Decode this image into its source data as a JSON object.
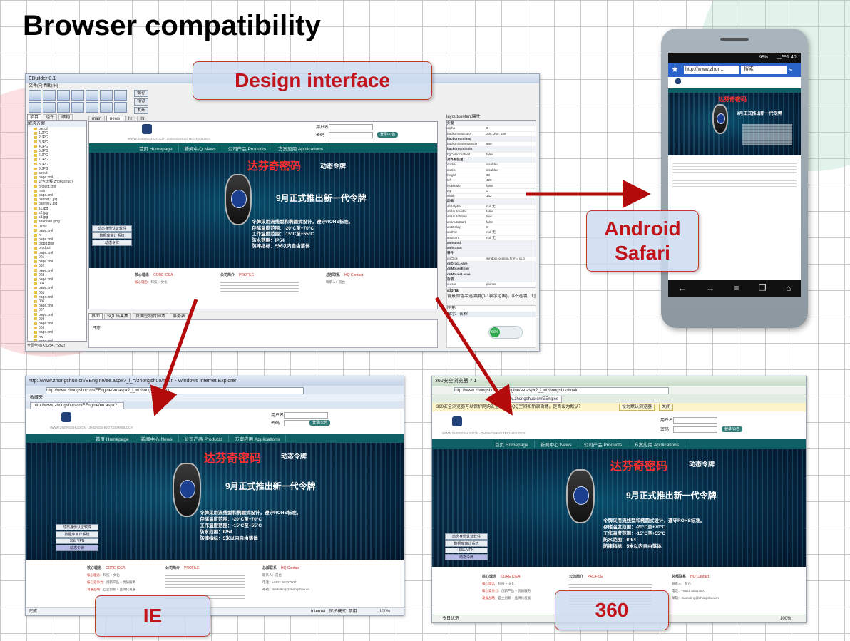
{
  "slide": {
    "title": "Browser compatibility",
    "callouts": {
      "design": "Design interface",
      "android_line1": "Android",
      "android_line2": "Safari",
      "ie": "IE",
      "b360": "360"
    }
  },
  "website": {
    "brand": "WWW.ZHONGSHUO.CN - ZHONGSHUO TECHNOLOGY",
    "login": {
      "user_label": "用户名",
      "pass_label": "密码",
      "button": "登录/公告"
    },
    "nav": [
      "首页 Homepage",
      "新闻中心 News",
      "公司产品 Products",
      "方案应用 Applications"
    ],
    "banner": {
      "product": "达芬奇密码",
      "product_sub": "动态令牌",
      "headline": "9月正式推出新一代令牌",
      "specs": [
        "令牌采用流线型和椭圆式设计，遵守ROHS标准。",
        "存储温度范围：-20°C至+70°C",
        "工作温度范围：-15°C至+55°C",
        "防水范围：IP54",
        "防摔指标：5米以内自由落体"
      ]
    },
    "side_menu": [
      "动态身份认证软件",
      "数据库审计系统",
      "SSL VPN",
      "动态令牌"
    ],
    "footer": {
      "col1_title": "核心理念",
      "col1_sub": "CORE IDEA",
      "col1_lines": [
        {
          "k": "核心理念：",
          "v": "科技 + 文化"
        },
        {
          "k": "核心竞争力：",
          "v": "创新产品 + 优质服务"
        },
        {
          "k": "发展战略：",
          "v": "自主创新 + 品牌化发展"
        }
      ],
      "col2_title": "公司简介",
      "col2_sub": "PROFILE",
      "col3_title": "总部联系",
      "col3_sub": "HQ Contact",
      "col3_lines": [
        "联系人：前台",
        "电话：+8621 50327007",
        "邮箱：marketing@zhongshuo.cn"
      ]
    }
  },
  "ide": {
    "title": "EBuilder 0.1",
    "menu": "文件(F)   帮助(H)",
    "side_buttons": [
      "保存",
      "预览",
      "发布"
    ],
    "left_tabs": [
      "项目",
      "组件",
      "结构"
    ],
    "tree_header": "解决方案",
    "tree_items": [
      "bar.gif",
      "1.JPG",
      "2.JPG",
      "3.JPG",
      "4.JPG",
      "5.JPG",
      "6.JPG",
      "7.JPG",
      "8.JPG",
      "9.JPG",
      "about",
      "page.xml",
      "公告流程(zhongshuo)",
      "project.xml",
      "main",
      "page.xml",
      "banner1.jpg",
      "banner2.jpg",
      "s1.jpg",
      "s2.jpg",
      "s3.jpg",
      "shadow1.png",
      "news",
      "page.xml",
      "hr",
      "page.xml",
      "bigbg.png",
      "product",
      "page.xml",
      "001",
      "page.xml",
      "002",
      "page.xml",
      "003",
      "page.xml",
      "004",
      "page.xml",
      "005",
      "page.xml",
      "006",
      "page.xml",
      "007",
      "page.xml",
      "008",
      "page.xml",
      "009",
      "page.xml",
      "hw",
      "page.xml"
    ],
    "doc_tabs": [
      "main",
      "news",
      "hr",
      "hr"
    ],
    "prop_title": "layoutcontent属性",
    "props": [
      {
        "k": "外观",
        "v": ""
      },
      {
        "k": "alpha",
        "v": "0"
      },
      {
        "k": "backgroundColor",
        "v": "208, 208, 208"
      },
      {
        "k": "backgroundImg",
        "v": ""
      },
      {
        "k": "backgroundImgMode",
        "v": "true"
      },
      {
        "k": "backgroundSkin",
        "v": ""
      },
      {
        "k": "bgColorEnabled",
        "v": "false"
      },
      {
        "k": "对齐和位置",
        "v": ""
      },
      {
        "k": "dockH",
        "v": "disabled"
      },
      {
        "k": "dockV",
        "v": "disabled"
      },
      {
        "k": "height",
        "v": "33"
      },
      {
        "k": "left",
        "v": "429"
      },
      {
        "k": "lockRatio",
        "v": "false"
      },
      {
        "k": "top",
        "v": "0"
      },
      {
        "k": "width",
        "v": "142"
      },
      {
        "k": "动画",
        "v": ""
      },
      {
        "k": "anitAlpha",
        "v": "null 无"
      },
      {
        "k": "anitAutoHide",
        "v": "false"
      },
      {
        "k": "anitAutoShow",
        "v": "true"
      },
      {
        "k": "anitAutoStart",
        "v": "false"
      },
      {
        "k": "anitDelay",
        "v": "0"
      },
      {
        "k": "anitFor",
        "v": "null 无"
      },
      {
        "k": "anitIcon",
        "v": "null 无"
      },
      {
        "k": "anitsEnd",
        "v": ""
      },
      {
        "k": "anitsStart",
        "v": ""
      },
      {
        "k": "事件",
        "v": ""
      },
      {
        "k": "onClick",
        "v": "window.location.href = xx.p"
      },
      {
        "k": "onDragLeave",
        "v": ""
      },
      {
        "k": "onMouseEnter",
        "v": ""
      },
      {
        "k": "onMouseLeave",
        "v": ""
      },
      {
        "k": "杂项",
        "v": ""
      },
      {
        "k": "cursor",
        "v": "pointer"
      },
      {
        "k": "layerName",
        "v": ""
      },
      {
        "k": "layerVisible",
        "v": "true"
      },
      {
        "k": "note",
        "v": ""
      }
    ],
    "prop_help_title": "alpha",
    "prop_help": "背景颜色半透明度(0-1表示范围)，0不透明，1全透明",
    "bottom_tabs": [
      "界面",
      "SQL结果集",
      "页面控制台脚本",
      "事务表"
    ],
    "log_tab": "日志",
    "status": "全局坐标(X:1294,Y:262)",
    "right_bottom_header": "图形",
    "right_bottom_cols": [
      "显示",
      "名称"
    ],
    "badge": "66%"
  },
  "ie": {
    "title": "http://www.zhongshuo.cn/EEngine/ee.aspx?_l_=/zhongshuo/main - Windows Internet Explorer",
    "address": "http://www.zhongshuo.cn/EEngine/ee.aspx?_l_=/zhongshuo/main",
    "tab": "http://www.zhongshuo.cn/EEngine/ee.aspx?...",
    "favorites": "收藏夹",
    "status_left": "完成",
    "status_right": "Internet | 保护模式: 禁用",
    "zoom": "100%"
  },
  "b360": {
    "title": "360安全浏览器 7.1",
    "address": "http://www.zhongshuo.cn/EEngine/ee.aspx?_l_=/zhongshuo/main",
    "tab": "www.zhongshuo.cn/EEngine",
    "notice": "360安全浏览器可以保护网购安全。秒开QQ空间和新浪微博，是否设为默认？",
    "notice_btn1": "设为默认浏览器",
    "notice_btn2": "关闭",
    "status_left": "今日优选",
    "zoom": "100%"
  },
  "android": {
    "status_time": "上午1:40",
    "status_signal": "95%",
    "address": "http://www.zhon...",
    "search": "搜索"
  }
}
